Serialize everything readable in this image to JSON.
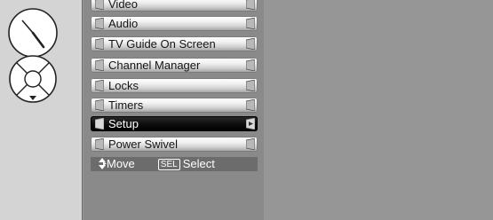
{
  "icons": {
    "dial": "dial-icon",
    "navigation_pad": "navigation-pad-icon"
  },
  "menu": {
    "items": [
      {
        "label": "Video",
        "selected": false
      },
      {
        "label": "Audio",
        "selected": false
      },
      {
        "label": "TV Guide On Screen",
        "selected": false
      },
      {
        "label": "Channel Manager",
        "selected": false
      },
      {
        "label": "Locks",
        "selected": false
      },
      {
        "label": "Timers",
        "selected": false
      },
      {
        "label": "Setup",
        "selected": true
      },
      {
        "label": "Power Swivel",
        "selected": false
      }
    ]
  },
  "hint": {
    "move_label": "Move",
    "sel_key": "SEL",
    "select_label": "Select"
  },
  "colors": {
    "background": "#969696",
    "side_panel": "#d4d4d4",
    "selected_item": "#000000",
    "hint_bar": "#6c6c6c"
  }
}
